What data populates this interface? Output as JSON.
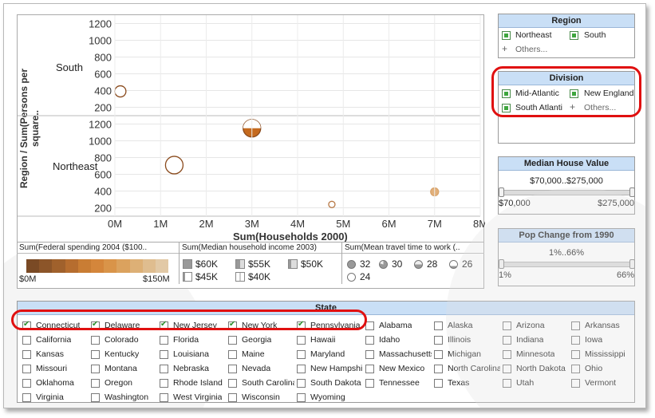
{
  "chart_data": {
    "type": "scatter",
    "xlabel": "Sum(Households 2000)",
    "ylabel": "Region / Sum(Persons per square..",
    "x_ticks": [
      "0M",
      "1M",
      "2M",
      "3M",
      "4M",
      "5M",
      "6M",
      "7M",
      "8M"
    ],
    "panes": [
      {
        "name": "South",
        "y_ticks": [
          "200",
          "400",
          "600",
          "800",
          "1000",
          "1200"
        ],
        "points": [
          {
            "x": 0.12,
            "y": 390,
            "r": 7
          }
        ]
      },
      {
        "name": "Northeast",
        "y_ticks": [
          "200",
          "400",
          "600",
          "800",
          "1000",
          "1200"
        ],
        "points": [
          {
            "x": 1.3,
            "y": 710,
            "r": 11
          },
          {
            "x": 3.0,
            "y": 1150,
            "r": 11
          },
          {
            "x": 4.75,
            "y": 240,
            "r": 4
          },
          {
            "x": 7.0,
            "y": 390,
            "r": 5
          }
        ]
      }
    ],
    "xlim": [
      0,
      8
    ],
    "ylim": [
      100,
      1300
    ]
  },
  "legends": {
    "spending": {
      "title": "Sum(Federal spending 2004 ($100..",
      "min": "$0M",
      "max": "$150M",
      "colors": [
        "#7a4a25",
        "#8c5529",
        "#a0612c",
        "#b66d2f",
        "#c97d34",
        "#d4863b",
        "#d99449",
        "#dba25e",
        "#ddb076",
        "#dfbd8f",
        "#e2c9a6"
      ]
    },
    "income": {
      "title": "Sum(Median household income 2003)",
      "items": [
        "$60K",
        "$55K",
        "$50K",
        "$45K",
        "$40K"
      ]
    },
    "travel": {
      "title": "Sum(Mean travel time to work (..",
      "items": [
        "32",
        "30",
        "28",
        "26",
        "24"
      ]
    }
  },
  "region": {
    "title": "Region",
    "items": [
      "Northeast",
      "South"
    ],
    "others": "Others..."
  },
  "division": {
    "title": "Division",
    "items": [
      "Mid-Atlantic",
      "New England",
      "South Atlanti"
    ],
    "others": "Others..."
  },
  "median_house": {
    "title": "Median House Value",
    "range": "$70,000..$275,000",
    "min": "$70,000",
    "max": "$275,000"
  },
  "pop_change": {
    "title": "Pop Change from 1990",
    "range": "1%..66%",
    "min": "1%",
    "max": "66%"
  },
  "state": {
    "title": "State",
    "rows": [
      [
        "Connecticut",
        "Delaware",
        "New Jersey",
        "New York",
        "Pennsylvania",
        "Alabama",
        "Alaska",
        "Arizona",
        "Arkansas"
      ],
      [
        "California",
        "Colorado",
        "Florida",
        "Georgia",
        "Hawaii",
        "Idaho",
        "Illinois",
        "Indiana",
        "Iowa"
      ],
      [
        "Kansas",
        "Kentucky",
        "Louisiana",
        "Maine",
        "Maryland",
        "Massachusetts",
        "Michigan",
        "Minnesota",
        "Mississippi"
      ],
      [
        "Missouri",
        "Montana",
        "Nebraska",
        "Nevada",
        "New Hampshire",
        "New Mexico",
        "North Carolina",
        "North Dakota",
        "Ohio"
      ],
      [
        "Oklahoma",
        "Oregon",
        "Rhode Island",
        "South Carolina",
        "South Dakota",
        "Tennessee",
        "Texas",
        "Utah",
        "Vermont"
      ],
      [
        "Virginia",
        "Washington",
        "West Virginia",
        "Wisconsin",
        "Wyoming"
      ]
    ],
    "checked": [
      "Connecticut",
      "Delaware",
      "New Jersey",
      "New York",
      "Pennsylvania"
    ]
  }
}
